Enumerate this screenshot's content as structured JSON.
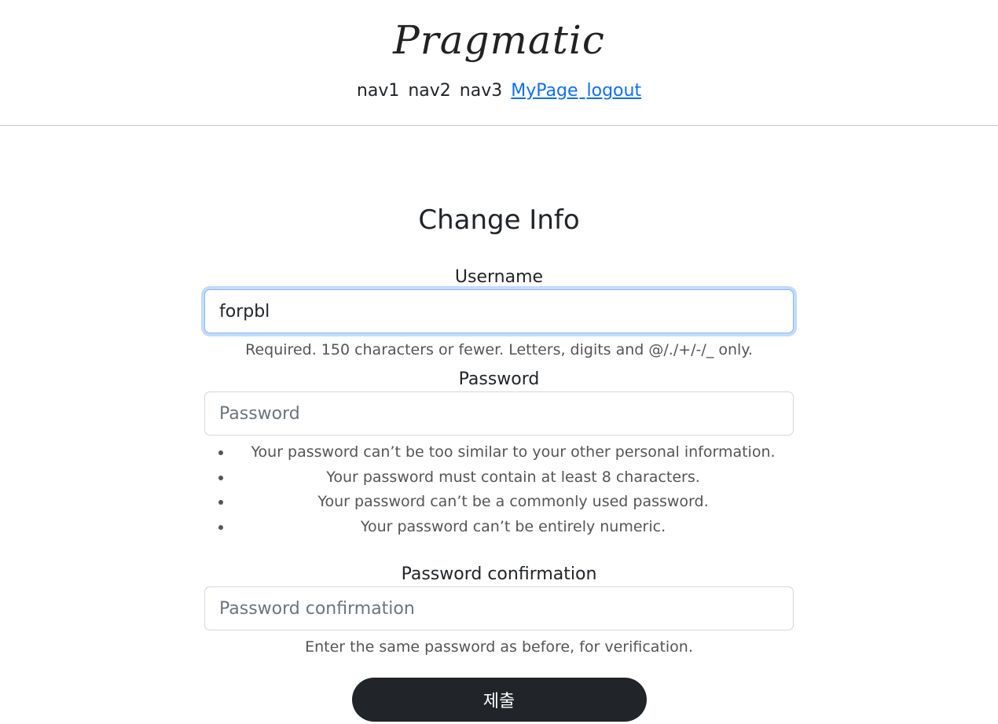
{
  "header": {
    "logo": "Pragmatic",
    "nav": [
      "nav1",
      "nav2",
      "nav3"
    ],
    "links": {
      "mypage": "MyPage",
      "logout": "logout"
    }
  },
  "form": {
    "title": "Change Info",
    "username": {
      "label": "Username",
      "value": "forpbl",
      "help": "Required. 150 characters or fewer. Letters, digits and @/./+/-/_ only."
    },
    "password": {
      "label": "Password",
      "placeholder": "Password",
      "rules": [
        "Your password can’t be too similar to your other personal information.",
        "Your password must contain at least 8 characters.",
        "Your password can’t be a commonly used password.",
        "Your password can’t be entirely numeric."
      ]
    },
    "password_confirmation": {
      "label": "Password confirmation",
      "placeholder": "Password confirmation",
      "help": "Enter the same password as before, for verification."
    },
    "submit_label": "제출"
  },
  "colors": {
    "link": "#0d6efd",
    "button_bg": "#212529",
    "focus_ring": "#86b7fe"
  }
}
